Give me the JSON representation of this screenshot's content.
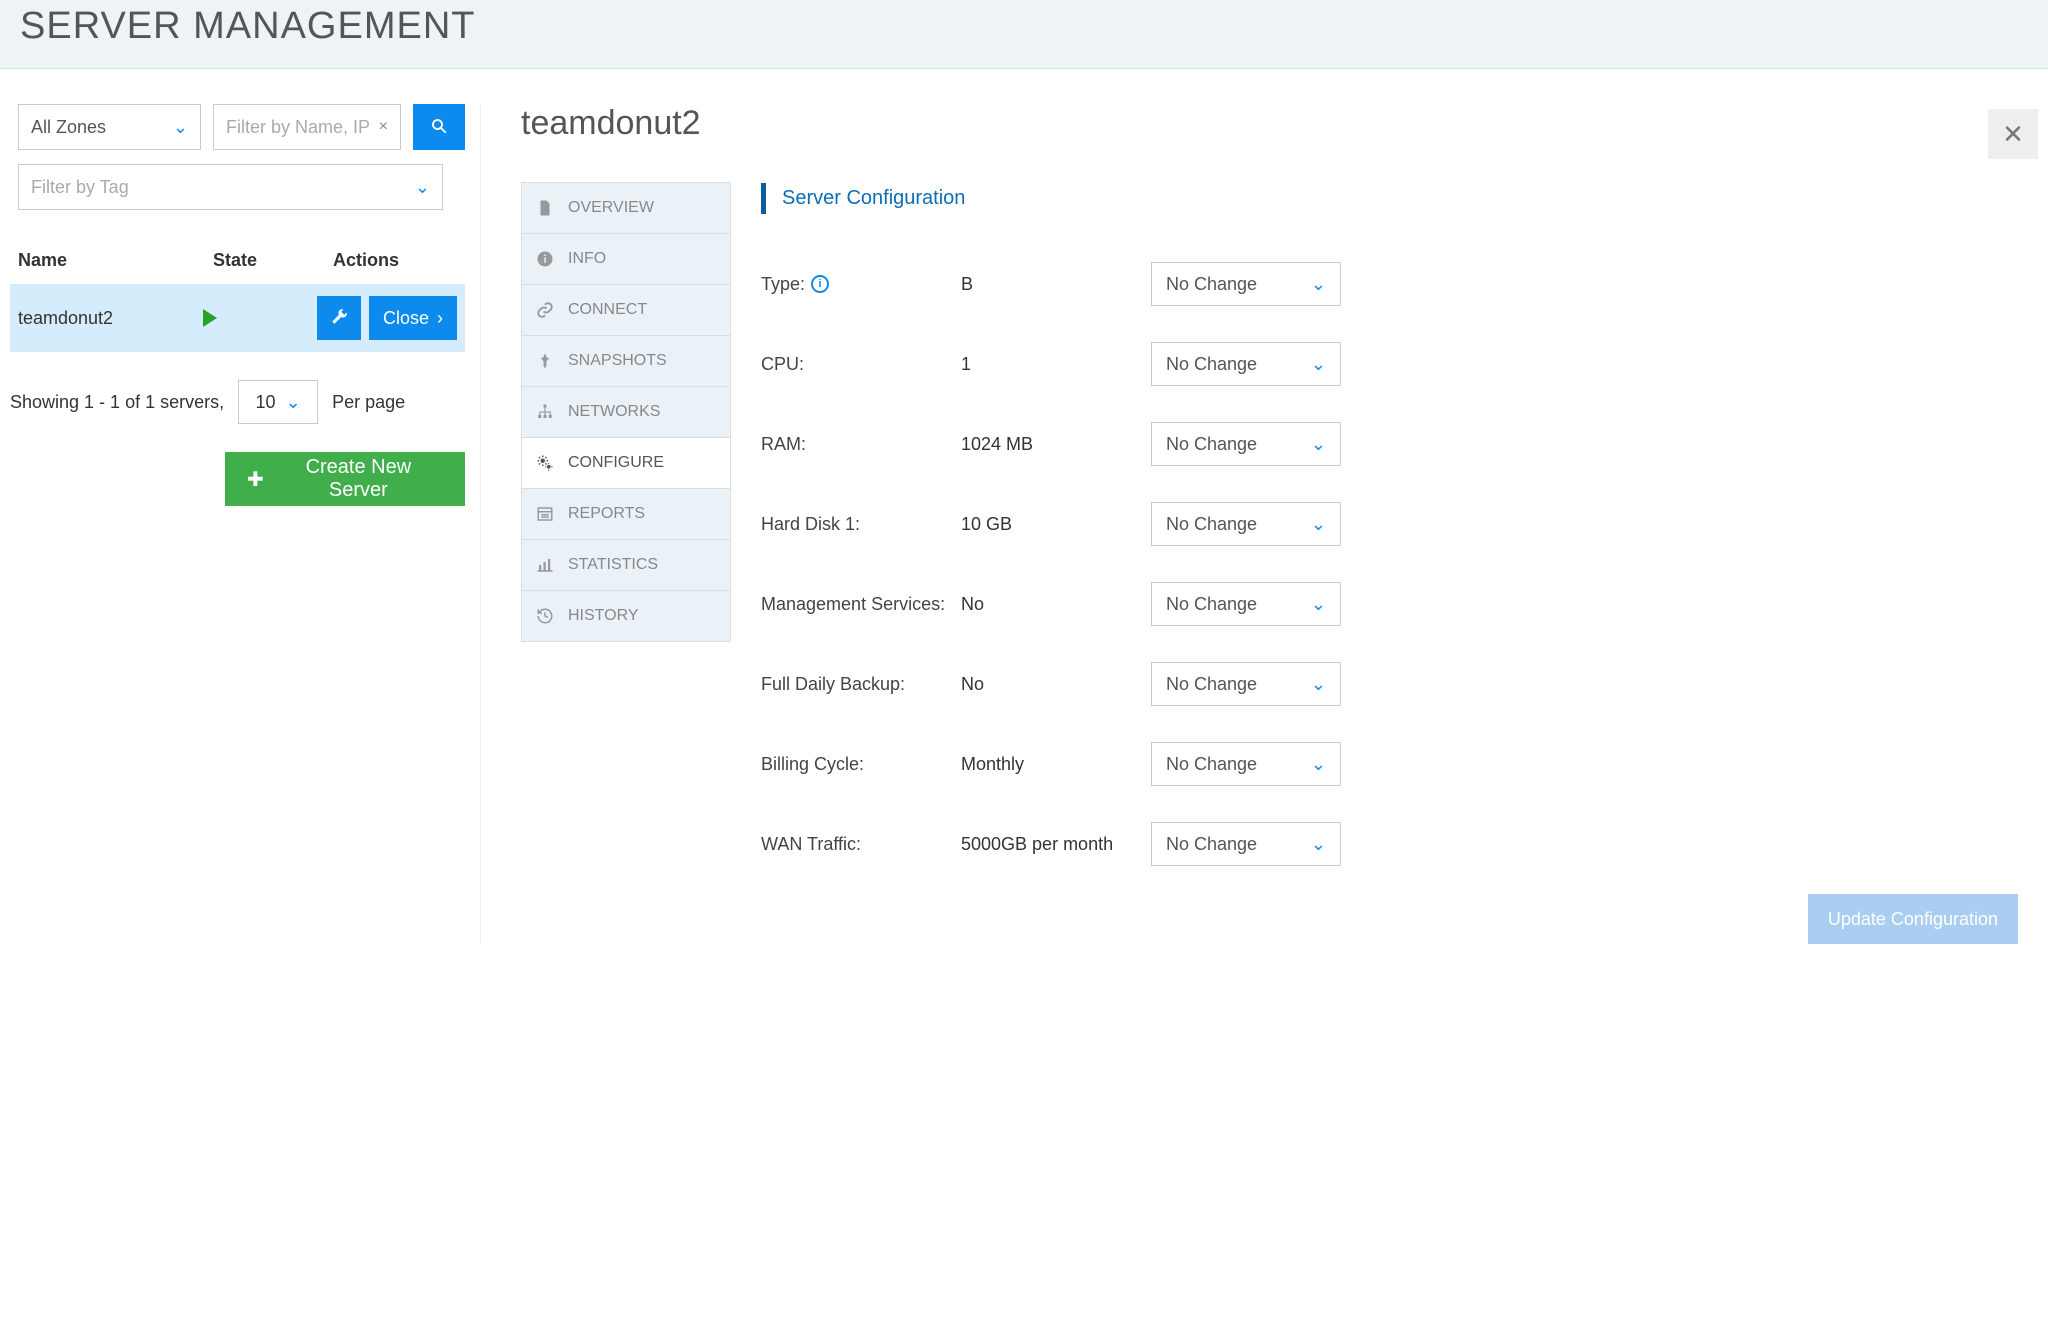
{
  "page": {
    "title": "SERVER MANAGEMENT"
  },
  "filters": {
    "zone_selected": "All Zones",
    "name_placeholder": "Filter by Name, IP",
    "tag_placeholder": "Filter by Tag"
  },
  "table": {
    "headers": {
      "name": "Name",
      "state": "State",
      "actions": "Actions"
    },
    "rows": [
      {
        "name": "teamdonut2",
        "close_label": "Close"
      }
    ]
  },
  "pagination": {
    "showing_text": "Showing 1 - 1 of 1 servers,",
    "per_page_value": "10",
    "per_page_label": "Per page"
  },
  "create_button": "Create New Server",
  "detail": {
    "server_name": "teamdonut2",
    "nav": [
      {
        "label": "OVERVIEW",
        "icon": "file"
      },
      {
        "label": "INFO",
        "icon": "info"
      },
      {
        "label": "CONNECT",
        "icon": "link"
      },
      {
        "label": "SNAPSHOTS",
        "icon": "pin"
      },
      {
        "label": "NETWORKS",
        "icon": "network"
      },
      {
        "label": "CONFIGURE",
        "icon": "gears",
        "active": true
      },
      {
        "label": "REPORTS",
        "icon": "report"
      },
      {
        "label": "STATISTICS",
        "icon": "bars"
      },
      {
        "label": "HISTORY",
        "icon": "history"
      }
    ],
    "panel_heading": "Server Configuration",
    "config": [
      {
        "label": "Type:",
        "value": "B",
        "select": "No Change",
        "info": true
      },
      {
        "label": "CPU:",
        "value": "1",
        "select": "No Change"
      },
      {
        "label": "RAM:",
        "value": "1024 MB",
        "select": "No Change"
      },
      {
        "label": "Hard Disk 1:",
        "value": "10 GB",
        "select": "No Change"
      },
      {
        "label": "Management Services:",
        "value": "No",
        "select": "No Change"
      },
      {
        "label": "Full Daily Backup:",
        "value": "No",
        "select": "No Change"
      },
      {
        "label": "Billing Cycle:",
        "value": "Monthly",
        "select": "No Change"
      },
      {
        "label": "WAN Traffic:",
        "value": "5000GB per month",
        "select": "No Change"
      }
    ],
    "update_button": "Update Configuration"
  }
}
